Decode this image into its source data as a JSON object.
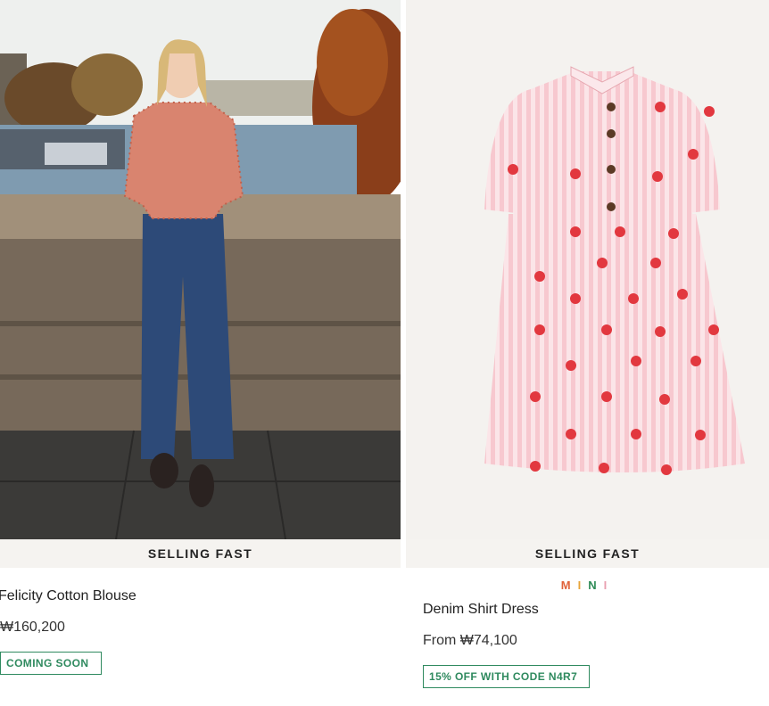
{
  "products": [
    {
      "ribbon": "SELLING FAST",
      "name": "Felicity Cotton Blouse",
      "price": "₩160,200",
      "badge": "COMING SOON",
      "image": "woman-in-red-blouse-and-jeans-by-river-photo"
    },
    {
      "ribbon": "SELLING FAST",
      "brand_letters": [
        "M",
        "I",
        "N",
        "I"
      ],
      "name": "Denim Shirt Dress",
      "price": "From ₩74,100",
      "badge": "15% OFF WITH CODE N4R7",
      "image": "pink-striped-heart-dress-photo"
    }
  ],
  "colors": {
    "accent_green": "#2f8a5f",
    "ribbon_bg": "#f5f3f0"
  }
}
